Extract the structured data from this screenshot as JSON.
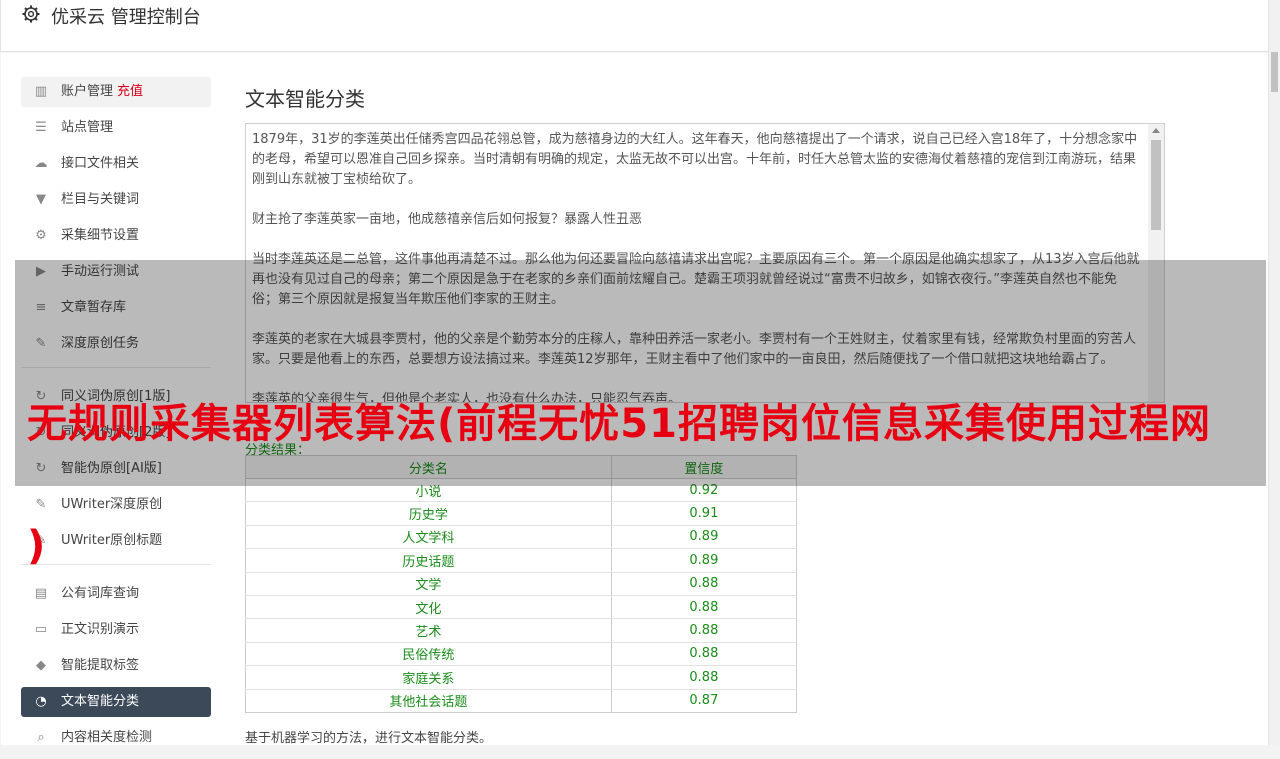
{
  "header": {
    "title": "优采云 管理控制台",
    "icon": "gear-icon"
  },
  "sidebar": {
    "groups": [
      [
        {
          "label": "账户管理",
          "badge": "充值",
          "icon": "bar-chart-icon",
          "name": "account"
        },
        {
          "label": "站点管理",
          "icon": "server-icon",
          "name": "site"
        },
        {
          "label": "接口文件相关",
          "icon": "cloud-upload-icon",
          "name": "api-files"
        },
        {
          "label": "栏目与关键词",
          "icon": "filter-icon",
          "name": "columns-keywords"
        },
        {
          "label": "采集细节设置",
          "icon": "cogs-icon",
          "name": "collect-settings"
        },
        {
          "label": "手动运行测试",
          "icon": "play-circle-icon",
          "name": "manual-test"
        },
        {
          "label": "文章暂存库",
          "icon": "database-icon",
          "name": "article-store"
        },
        {
          "label": "深度原创任务",
          "icon": "edit-icon",
          "name": "deep-original"
        }
      ],
      [
        {
          "label": "同义词伪原创[1版]",
          "icon": "refresh-icon",
          "name": "synonym-v1"
        },
        {
          "label": "同义词伪原创[2版]",
          "icon": "refresh-icon",
          "name": "synonym-v2"
        },
        {
          "label": "智能伪原创[AI版]",
          "icon": "refresh-icon",
          "name": "ai-rewrite"
        },
        {
          "label": "UWriter深度原创",
          "icon": "edit-icon",
          "name": "uwriter-deep"
        },
        {
          "label": "UWriter原创标题",
          "icon": "edit-icon",
          "name": "uwriter-title"
        }
      ],
      [
        {
          "label": "公有词库查询",
          "icon": "book-icon",
          "name": "public-lexicon"
        },
        {
          "label": "正文识别演示",
          "icon": "monitor-icon",
          "name": "body-recognition"
        },
        {
          "label": "智能提取标签",
          "icon": "tag-icon",
          "name": "extract-tags"
        },
        {
          "label": "文本智能分类",
          "icon": "pie-chart-icon",
          "name": "text-classify",
          "active": true
        },
        {
          "label": "内容相关度检测",
          "icon": "search-icon",
          "name": "relevance-check"
        }
      ]
    ]
  },
  "main": {
    "title": "文本智能分类",
    "text_paragraphs": [
      "1879年，31岁的李莲英出任储秀宫四品花翎总管，成为慈禧身边的大红人。这年春天，他向慈禧提出了一个请求，说自己已经入宫18年了，十分想念家中的老母，希望可以恩准自己回乡探亲。当时清朝有明确的规定，太监无故不可以出宫。十年前，时任大总管太监的安德海仗着慈禧的宠信到江南游玩，结果刚到山东就被丁宝桢给砍了。",
      "财主抢了李莲英家一亩地，他成慈禧亲信后如何报复？暴露人性丑恶",
      "当时李莲英还是二总管，这件事他再清楚不过。那么他为何还要冒险向慈禧请求出宫呢？主要原因有三个。第一个原因是他确实想家了，从13岁入宫后他就再也没有见过自己的母亲；第二个原因是急于在老家的乡亲们面前炫耀自己。楚霸王项羽就曾经说过“富贵不归故乡，如锦衣夜行。”李莲英自然也不能免俗；第三个原因就是报复当年欺压他们李家的王财主。",
      "李莲英的老家在大城县李贾村，他的父亲是个勤劳本分的庄稼人，靠种田养活一家老小。李贾村有一个王姓财主，仗着家里有钱，经常欺负村里面的穷苦人家。只要是他看上的东西，总要想方设法搞过来。李莲英12岁那年，王财主看中了他们家中的一亩良田，然后随便找了一个借口就把这块地给霸占了。",
      "李莲英的父亲很生气，但他是个老实人，也没有什么办法，只能忍气吞声。"
    ],
    "result_label": "分类结果：",
    "table_headers": [
      "分类名",
      "置信度"
    ],
    "table_rows": [
      [
        "小说",
        "0.92"
      ],
      [
        "历史学",
        "0.91"
      ],
      [
        "人文学科",
        "0.89"
      ],
      [
        "历史话题",
        "0.89"
      ],
      [
        "文学",
        "0.88"
      ],
      [
        "文化",
        "0.88"
      ],
      [
        "艺术",
        "0.88"
      ],
      [
        "民俗传统",
        "0.88"
      ],
      [
        "家庭关系",
        "0.88"
      ],
      [
        "其他社会话题",
        "0.87"
      ]
    ],
    "description": "基于机器学习的方法，进行文本智能分类。"
  },
  "overlay": {
    "line1": "无规则采集器列表算法(前程无忧51招聘岗位信息采集使用过程网",
    "line2": ")"
  },
  "colors": {
    "active_bg": "#3b4959",
    "result_green": "#1a8c1a",
    "overlay_red": "#e60012",
    "recharge_red": "#d9001b"
  }
}
